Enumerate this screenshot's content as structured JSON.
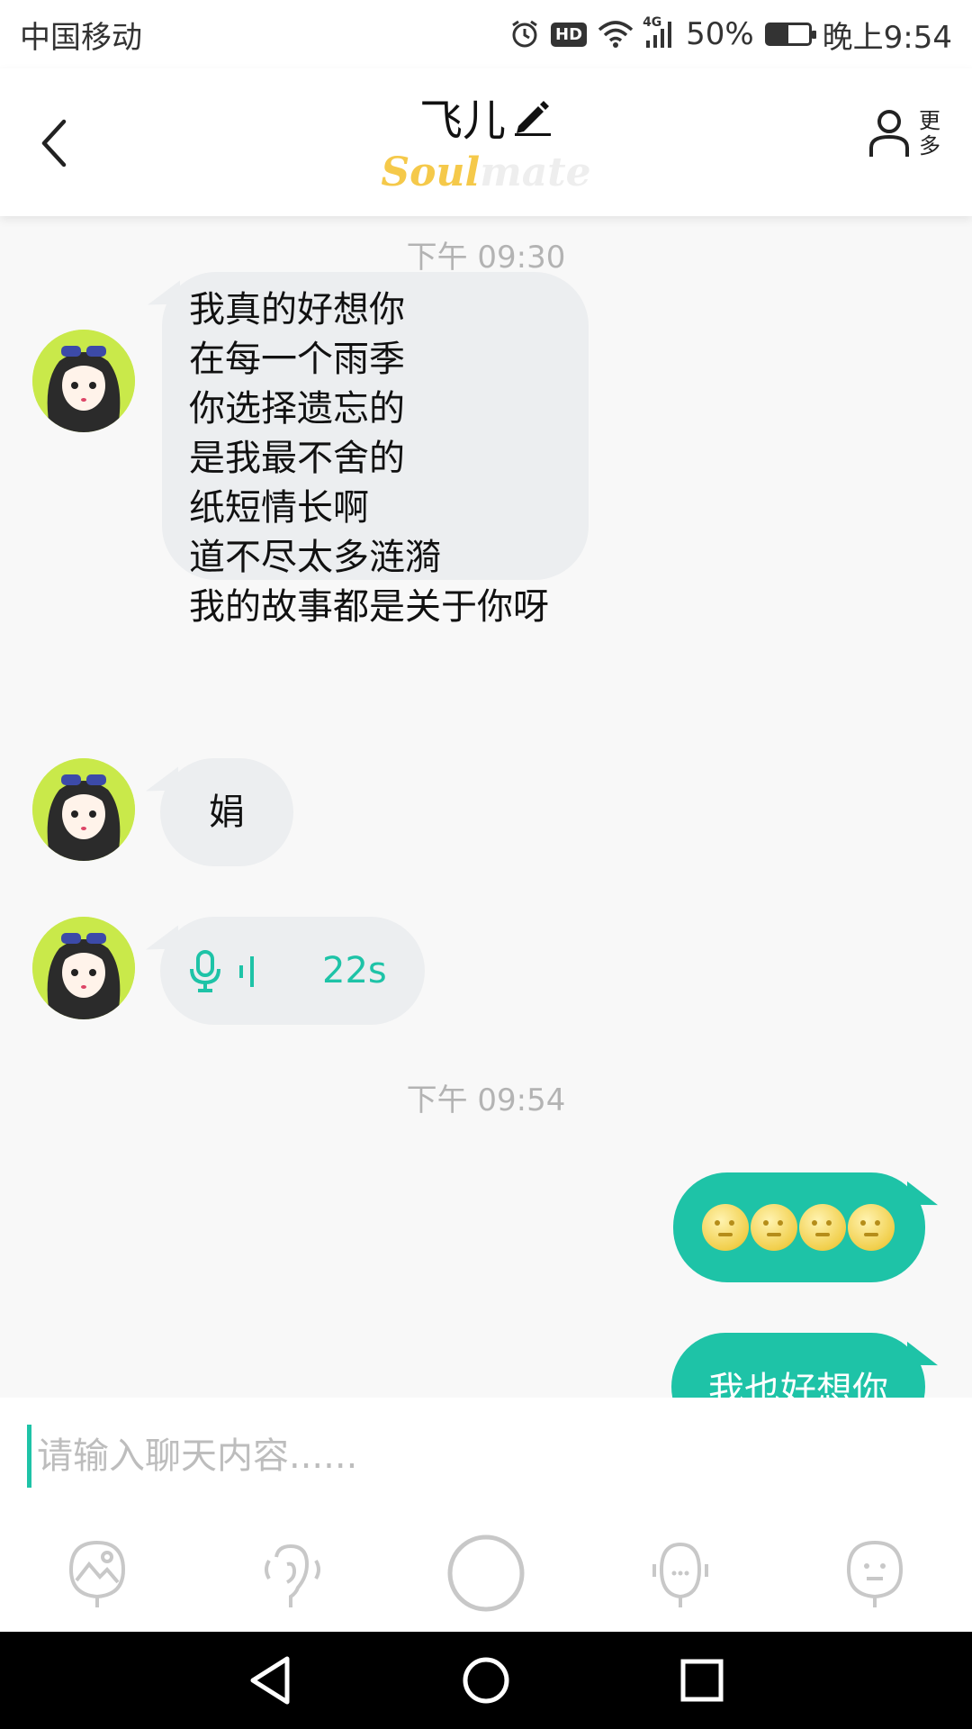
{
  "status_bar": {
    "carrier": "中国移动",
    "network": "4G",
    "battery": "50%",
    "battery_level": 0.5,
    "time": "晚上9:54",
    "hd": "HD"
  },
  "header": {
    "title": "飞儿",
    "brand_soul": "Soul",
    "brand_mate": "mate",
    "more_label": "更多"
  },
  "chat": {
    "timestamps": [
      "下午 09:30",
      "下午 09:54"
    ],
    "messages": [
      {
        "from": "other",
        "lines": [
          "我真的好想你",
          "在每一个雨季",
          "你选择遗忘的",
          "是我最不舍的",
          "纸短情长啊",
          "道不尽太多涟漪",
          "我的故事都是关于你呀"
        ]
      },
      {
        "from": "other",
        "text": "娟"
      },
      {
        "from": "other",
        "voice_duration": "22s"
      },
      {
        "from": "me",
        "emoji_count": 4
      },
      {
        "from": "me",
        "text": "我也好想你"
      }
    ]
  },
  "input": {
    "placeholder": "请输入聊天内容......"
  },
  "toolbar": {
    "icons": [
      "image-icon",
      "voice-call-icon",
      "record-button-icon",
      "microphone-icon",
      "emoji-icon"
    ]
  },
  "colors": {
    "accent": "#1ec3a7",
    "incoming_bubble": "#eceef0",
    "timestamp": "#b3b3b3",
    "brand_yellow": "#f5c94a"
  }
}
